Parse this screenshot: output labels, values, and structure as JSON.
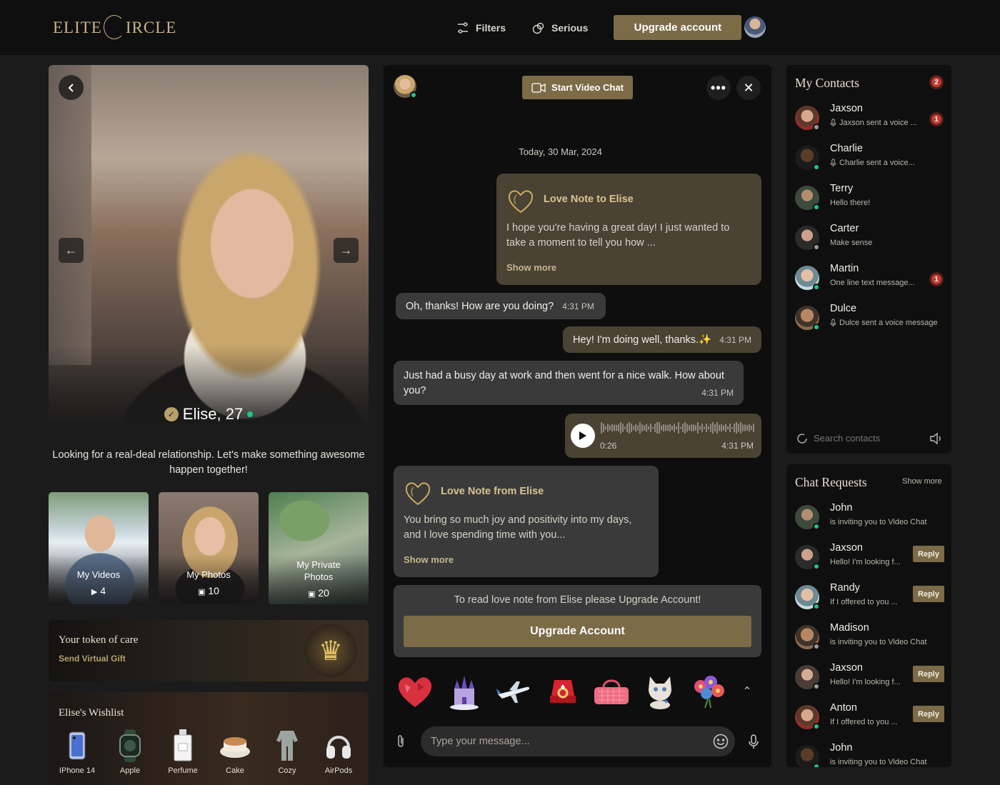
{
  "brand": {
    "logo_left": "ELITE",
    "logo_right": "IRCLE"
  },
  "header": {
    "filters_label": "Filters",
    "serious_label": "Serious",
    "upgrade_label": "Upgrade account"
  },
  "profile": {
    "name": "Elise, 27",
    "bio": "Looking for a real-deal relationship. Let's make something awesome happen together!",
    "media": [
      {
        "label": "My Videos",
        "count": "4",
        "icon": "play-icon"
      },
      {
        "label": "My Photos",
        "count": "10",
        "icon": "photo-icon"
      },
      {
        "label": "My Private Photos",
        "count": "20",
        "icon": "photo-icon"
      }
    ],
    "gift": {
      "title": "Your token of care",
      "link": "Send Virtual Gift",
      "icon": "crown-icon"
    },
    "wishlist": {
      "title": "Elise's Wishlist",
      "items": [
        {
          "name": "IPhone 14",
          "icon": "phone-icon"
        },
        {
          "name": "Apple",
          "icon": "watch-icon"
        },
        {
          "name": "Perfume",
          "icon": "perfume-icon"
        },
        {
          "name": "Cake",
          "icon": "cake-icon"
        },
        {
          "name": "Cozy",
          "icon": "clothes-icon"
        },
        {
          "name": "AirPods",
          "icon": "headphones-icon"
        }
      ]
    }
  },
  "chat": {
    "video_button": "Start Video Chat",
    "date": "Today, 30 Mar, 2024",
    "note1": {
      "title": "Love Note to Elise",
      "body": "I hope you're having a great day! I just wanted to take a moment to tell you how ...",
      "more": "Show more"
    },
    "msg1": {
      "text": "Oh, thanks! How are you doing?",
      "time": "4:31 PM"
    },
    "msg2": {
      "text": "Hey! I'm doing well, thanks.✨",
      "time": "4:31 PM"
    },
    "msg3": {
      "text": "Just had a busy day at work and then went for a nice walk. How about you?",
      "time": "4:31 PM"
    },
    "voice": {
      "duration": "0:26",
      "time": "4:31 PM"
    },
    "note2": {
      "title": "Love Note from Elise",
      "body": "You bring so much joy and positivity into my days, and I love spending time with you...",
      "more": "Show more"
    },
    "upgrade": {
      "text": "To read love note from Elise please Upgrade Account!",
      "button": "Upgrade Account"
    },
    "gifts": [
      "heart",
      "castle",
      "plane",
      "ring-box",
      "handbag",
      "kitten",
      "bouquet"
    ],
    "input_placeholder": "Type your message..."
  },
  "contacts": {
    "title": "My Contacts",
    "badge": "2",
    "items": [
      {
        "name": "Jaxson",
        "msg": "Jaxson sent a voice ...",
        "voice": true,
        "unread": "1",
        "status": "offline"
      },
      {
        "name": "Charlie",
        "msg": "Charlie sent a voice...",
        "voice": true,
        "unread": "",
        "status": "online"
      },
      {
        "name": "Terry",
        "msg": "Hello there!",
        "voice": false,
        "unread": "",
        "status": "online"
      },
      {
        "name": "Carter",
        "msg": "Make sense",
        "voice": false,
        "unread": "",
        "status": "offline"
      },
      {
        "name": "Martin",
        "msg": "One line text message...",
        "voice": false,
        "unread": "1",
        "status": "online"
      },
      {
        "name": "Dulce",
        "msg": "Dulce sent a voice message",
        "voice": true,
        "unread": "",
        "status": "online"
      }
    ],
    "search_placeholder": "Search contacts"
  },
  "requests": {
    "title": "Chat Requests",
    "more": "Show more",
    "reply_label": "Reply",
    "items": [
      {
        "name": "John",
        "msg": "is inviting you to Video Chat",
        "reply": false,
        "status": "online"
      },
      {
        "name": "Jaxson",
        "msg": "Hello! I'm looking f...",
        "reply": true,
        "status": "online"
      },
      {
        "name": "Randy",
        "msg": "If I offered to you ...",
        "reply": true,
        "status": "online"
      },
      {
        "name": "Madison",
        "msg": "is inviting you to Video Chat",
        "reply": false,
        "status": "offline"
      },
      {
        "name": "Jaxson",
        "msg": "Hello! I'm looking f...",
        "reply": true,
        "status": "offline"
      },
      {
        "name": "Anton",
        "msg": "If I offered to you ...",
        "reply": true,
        "status": "online"
      },
      {
        "name": "John",
        "msg": "is inviting you to Video Chat",
        "reply": false,
        "status": "online"
      }
    ]
  },
  "colors": {
    "accent": "#7b6b47",
    "gold": "#c9b38a",
    "online": "#1ec58a",
    "badge": "#c13b30"
  }
}
